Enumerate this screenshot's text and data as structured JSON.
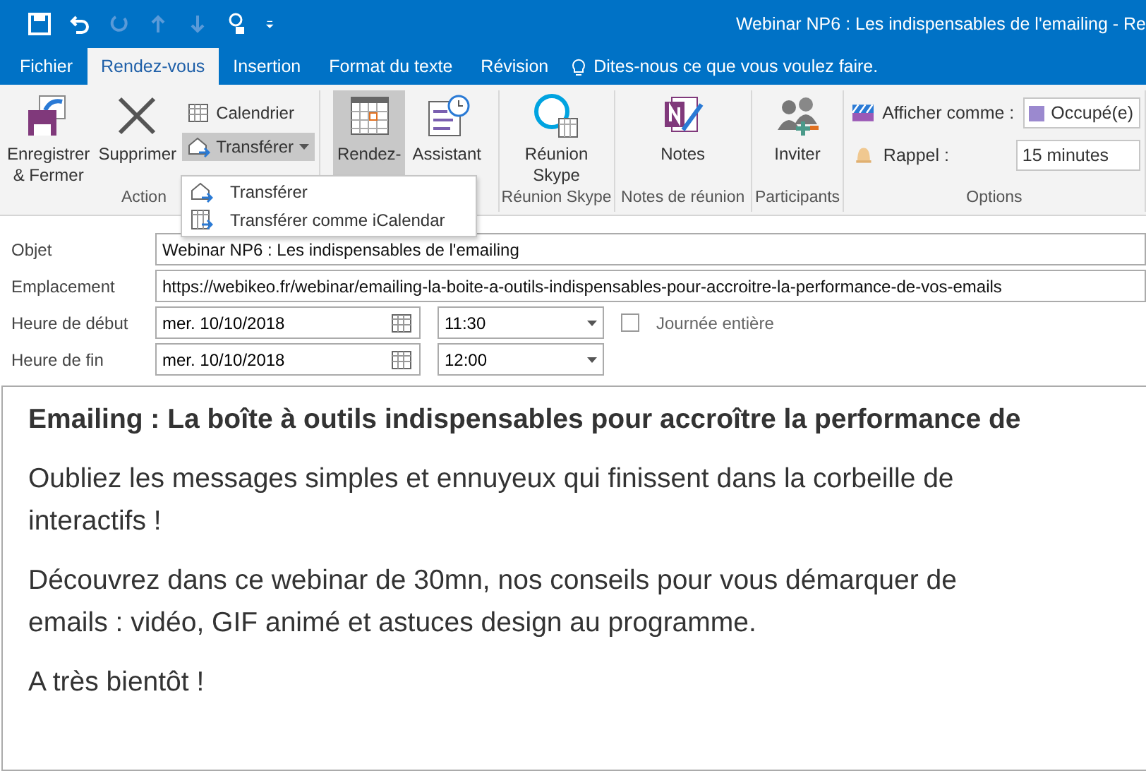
{
  "window": {
    "title": "Webinar NP6 : Les indispensables de l'emailing  - Re"
  },
  "tabs": [
    {
      "label": "Fichier",
      "selected": false
    },
    {
      "label": "Rendez-vous",
      "selected": true
    },
    {
      "label": "Insertion",
      "selected": false
    },
    {
      "label": "Format du texte",
      "selected": false
    },
    {
      "label": "Révision",
      "selected": false
    }
  ],
  "tell_me": {
    "placeholder": "Dites-nous ce que vous voulez faire."
  },
  "ribbon": {
    "groups": [
      {
        "label": "Action",
        "kind": "actions",
        "big": [
          {
            "label": "Enregistrer\n& Fermer"
          },
          {
            "label": "Supprimer"
          }
        ],
        "small": [
          {
            "label": "Calendrier",
            "pressed": false
          },
          {
            "label": "Transférer",
            "pressed": true
          }
        ]
      },
      {
        "kind": "big",
        "big": [
          {
            "label": "Rendez-",
            "pressed": true
          },
          {
            "label": "Assistant",
            "pressed": false
          }
        ]
      },
      {
        "label": "Réunion Skype",
        "kind": "big",
        "big": [
          {
            "label": "Réunion\nSkype",
            "pressed": false
          }
        ]
      },
      {
        "label": "Notes de réunion",
        "kind": "big",
        "big": [
          {
            "label": "Notes",
            "pressed": false
          }
        ]
      },
      {
        "label": "Participants",
        "kind": "big",
        "big": [
          {
            "label": "Inviter",
            "pressed": false
          }
        ]
      },
      {
        "label": "Options",
        "kind": "options",
        "show_as": {
          "label": "Afficher comme :",
          "value": "Occupé(e)",
          "color": "#9b89cf"
        },
        "reminder": {
          "label": "Rappel :",
          "value": "15 minutes"
        }
      }
    ]
  },
  "forward_menu": {
    "items": [
      {
        "label": "Transférer"
      },
      {
        "label": "Transférer comme iCalendar"
      }
    ]
  },
  "form": {
    "subject": {
      "label": "Objet",
      "value": "Webinar NP6 : Les indispensables de l'emailing"
    },
    "location": {
      "label": "Emplacement",
      "value": "https://webikeo.fr/webinar/emailing-la-boite-a-outils-indispensables-pour-accroitre-la-performance-de-vos-emails"
    },
    "start": {
      "label": "Heure de début",
      "date": "mer. 10/10/2018",
      "time": "11:30"
    },
    "end": {
      "label": "Heure de fin",
      "date": "mer. 10/10/2018",
      "time": "12:00"
    },
    "all_day": {
      "label": "Journée entière",
      "checked": false
    }
  },
  "body": {
    "paragraphs": [
      {
        "kind": "heading",
        "lines": [
          "Emailing : La boîte à outils indispensables pour accroître la performance de"
        ]
      },
      {
        "kind": "text",
        "lines": [
          "Oubliez les messages simples et ennuyeux qui finissent dans la corbeille de",
          "interactifs !"
        ]
      },
      {
        "kind": "text",
        "lines": [
          "Découvrez dans ce webinar de 30mn, nos conseils pour vous démarquer de",
          "emails : vidéo, GIF animé et astuces design au programme."
        ]
      },
      {
        "kind": "text",
        "lines": [
          "A très bientôt !"
        ]
      }
    ]
  }
}
